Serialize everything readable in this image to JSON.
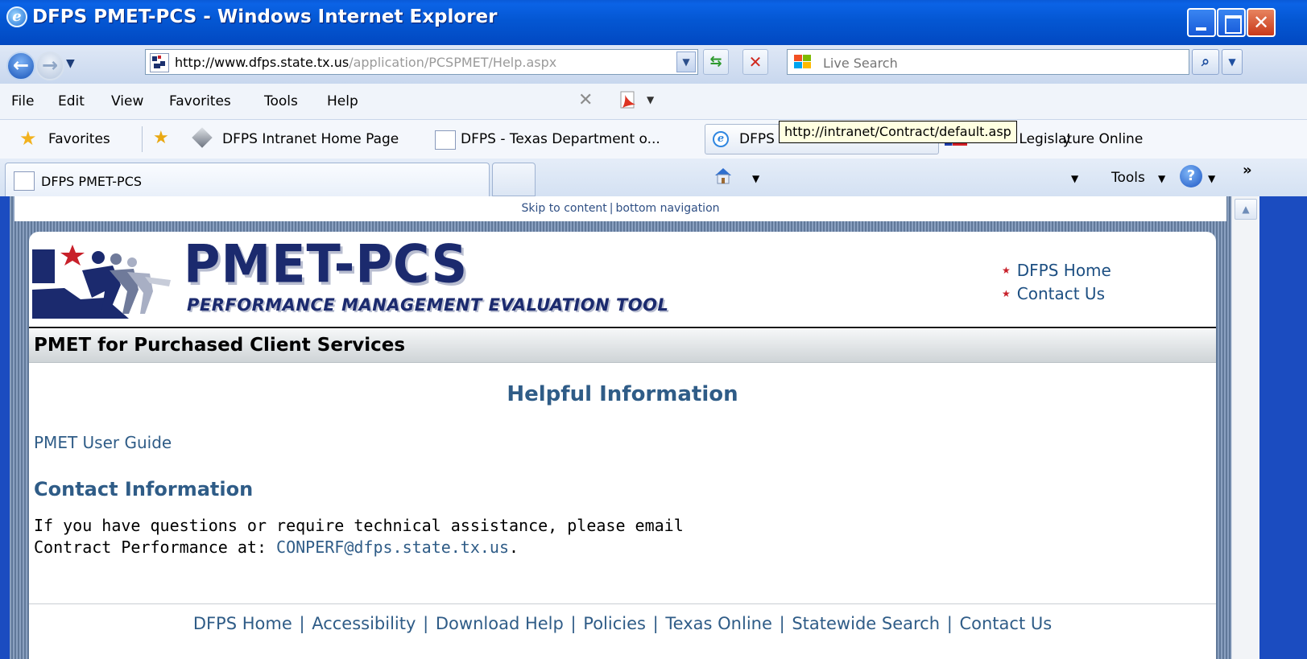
{
  "window": {
    "title": "DFPS PMET-PCS - Windows Internet Explorer"
  },
  "address": {
    "url_domain": "http://www.dfps.state.tx.us",
    "url_path": "/application/PCSPMET/Help.aspx",
    "search_placeholder": "Live Search"
  },
  "menu": {
    "items": [
      "File",
      "Edit",
      "View",
      "Favorites",
      "Tools",
      "Help"
    ]
  },
  "favorites_bar": {
    "favorites_label": "Favorites",
    "items": [
      "DFPS Intranet Home Page",
      "DFPS - Texas Department o...",
      "DFPS Contract Handbook",
      "Texas Legislature Online"
    ]
  },
  "tabs": {
    "active_tab": "DFPS PMET-PCS",
    "tooltip": "http://intranet/Contract/default.asp",
    "tooltip_tail": "y",
    "tools_label": "Tools"
  },
  "page": {
    "skip_content": "Skip to content",
    "skip_bottom_nav": "bottom navigation",
    "logo_title": "PMET-PCS",
    "logo_subtitle": "PERFORMANCE MANAGEMENT EVALUATION TOOL",
    "top_links": [
      "DFPS Home",
      "Contact Us"
    ],
    "section_title": "PMET for Purchased Client Services",
    "helpful_heading": "Helpful Information",
    "user_guide_link": "PMET User Guide",
    "contact_heading": "Contact Information",
    "contact_line1": "If you have questions or require technical assistance, please email",
    "contact_line2_prefix": "Contract Performance at: ",
    "contact_email": "CONPERF@dfps.state.tx.us",
    "contact_line2_suffix": ".",
    "footer_links": [
      "DFPS Home",
      "Accessibility",
      "Download Help",
      "Policies",
      "Texas Online",
      "Statewide Search",
      "Contact Us"
    ]
  },
  "colors": {
    "titlebar": "#0457d3",
    "link": "#2f5c87",
    "logo": "#1b2a6e"
  }
}
